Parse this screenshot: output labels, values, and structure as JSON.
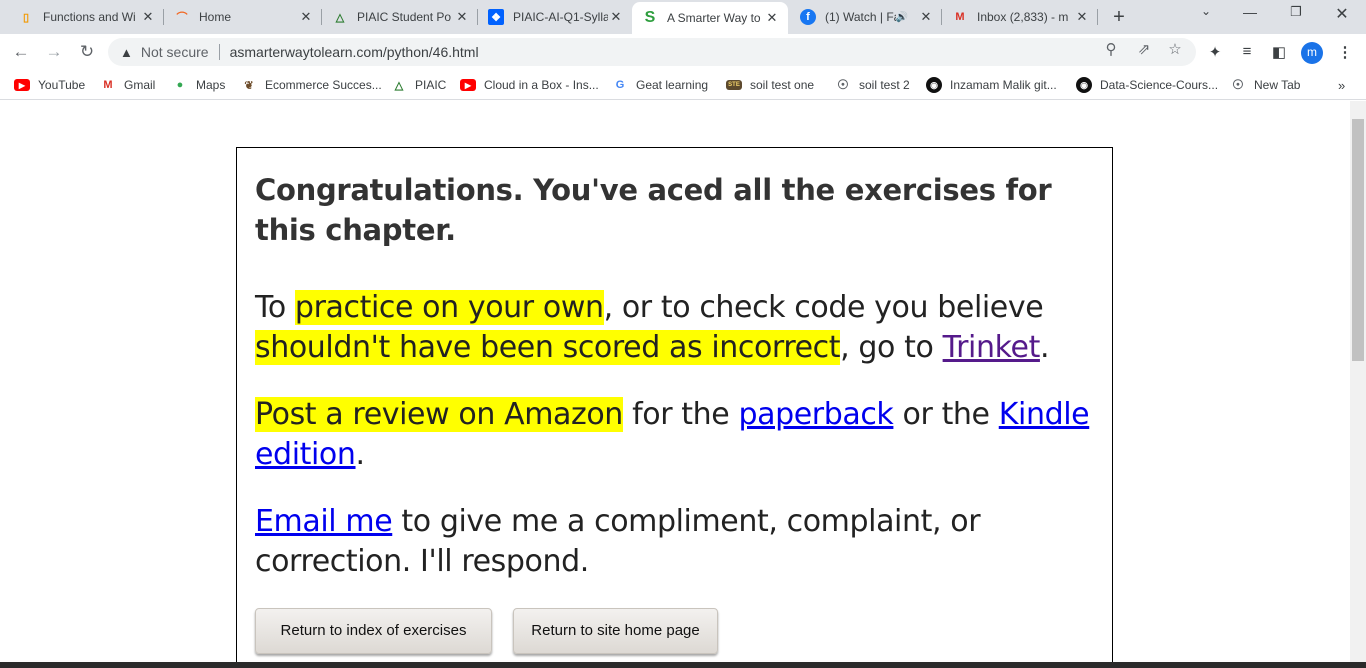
{
  "tabs": [
    {
      "title": "Functions and Wi",
      "icon": "book-icon",
      "color": "#f29900"
    },
    {
      "title": "Home",
      "icon": "loading-icon",
      "color": "#f26722"
    },
    {
      "title": "PIAIC Student Po",
      "icon": "piaic-icon",
      "color": "#2e7d32"
    },
    {
      "title": "PIAIC-AI-Q1-Sylla",
      "icon": "dropbox-icon",
      "color": "#0061fe"
    },
    {
      "title": "A Smarter Way to",
      "icon": "s-icon",
      "color": "#2e9e3e"
    },
    {
      "title": "(1) Watch | Fa",
      "icon": "facebook-icon",
      "color": "#1877f2"
    },
    {
      "title": "Inbox (2,833) - m",
      "icon": "gmail-icon",
      "color": "#d93025"
    }
  ],
  "toolbar": {
    "security_label": "Not secure",
    "url": "asmarterwaytolearn.com/python/46.html",
    "avatar_letter": "m"
  },
  "bookmarks": [
    {
      "label": "YouTube"
    },
    {
      "label": "Gmail"
    },
    {
      "label": "Maps"
    },
    {
      "label": "Ecommerce Succes..."
    },
    {
      "label": "PIAIC"
    },
    {
      "label": "Cloud in a Box - Ins..."
    },
    {
      "label": "Geat learning"
    },
    {
      "label": "soil test one"
    },
    {
      "label": "soil test 2"
    },
    {
      "label": "Inzamam Malik git..."
    },
    {
      "label": "Data-Science-Cours..."
    },
    {
      "label": "New Tab"
    }
  ],
  "content": {
    "heading": "Congratulations. You've aced all the exercises for this chapter.",
    "p1": {
      "t1": "To ",
      "hl1": "practice on your own",
      "t2": ", or to check code you believe ",
      "hl2": "shouldn't have been scored as incorrect",
      "t3": ", go to ",
      "link": "Trinket",
      "t4": "."
    },
    "p2": {
      "hl": "Post a review on Amazon",
      "t1": " for the ",
      "link1": "paperback",
      "t2": " or the ",
      "link2": "Kindle edition",
      "t3": "."
    },
    "p3": {
      "link": "Email me",
      "t1": " to give me a compliment, complaint, or correction. I'll respond."
    },
    "buttons": {
      "index": "Return to index of exercises",
      "home": "Return to site home page"
    }
  }
}
